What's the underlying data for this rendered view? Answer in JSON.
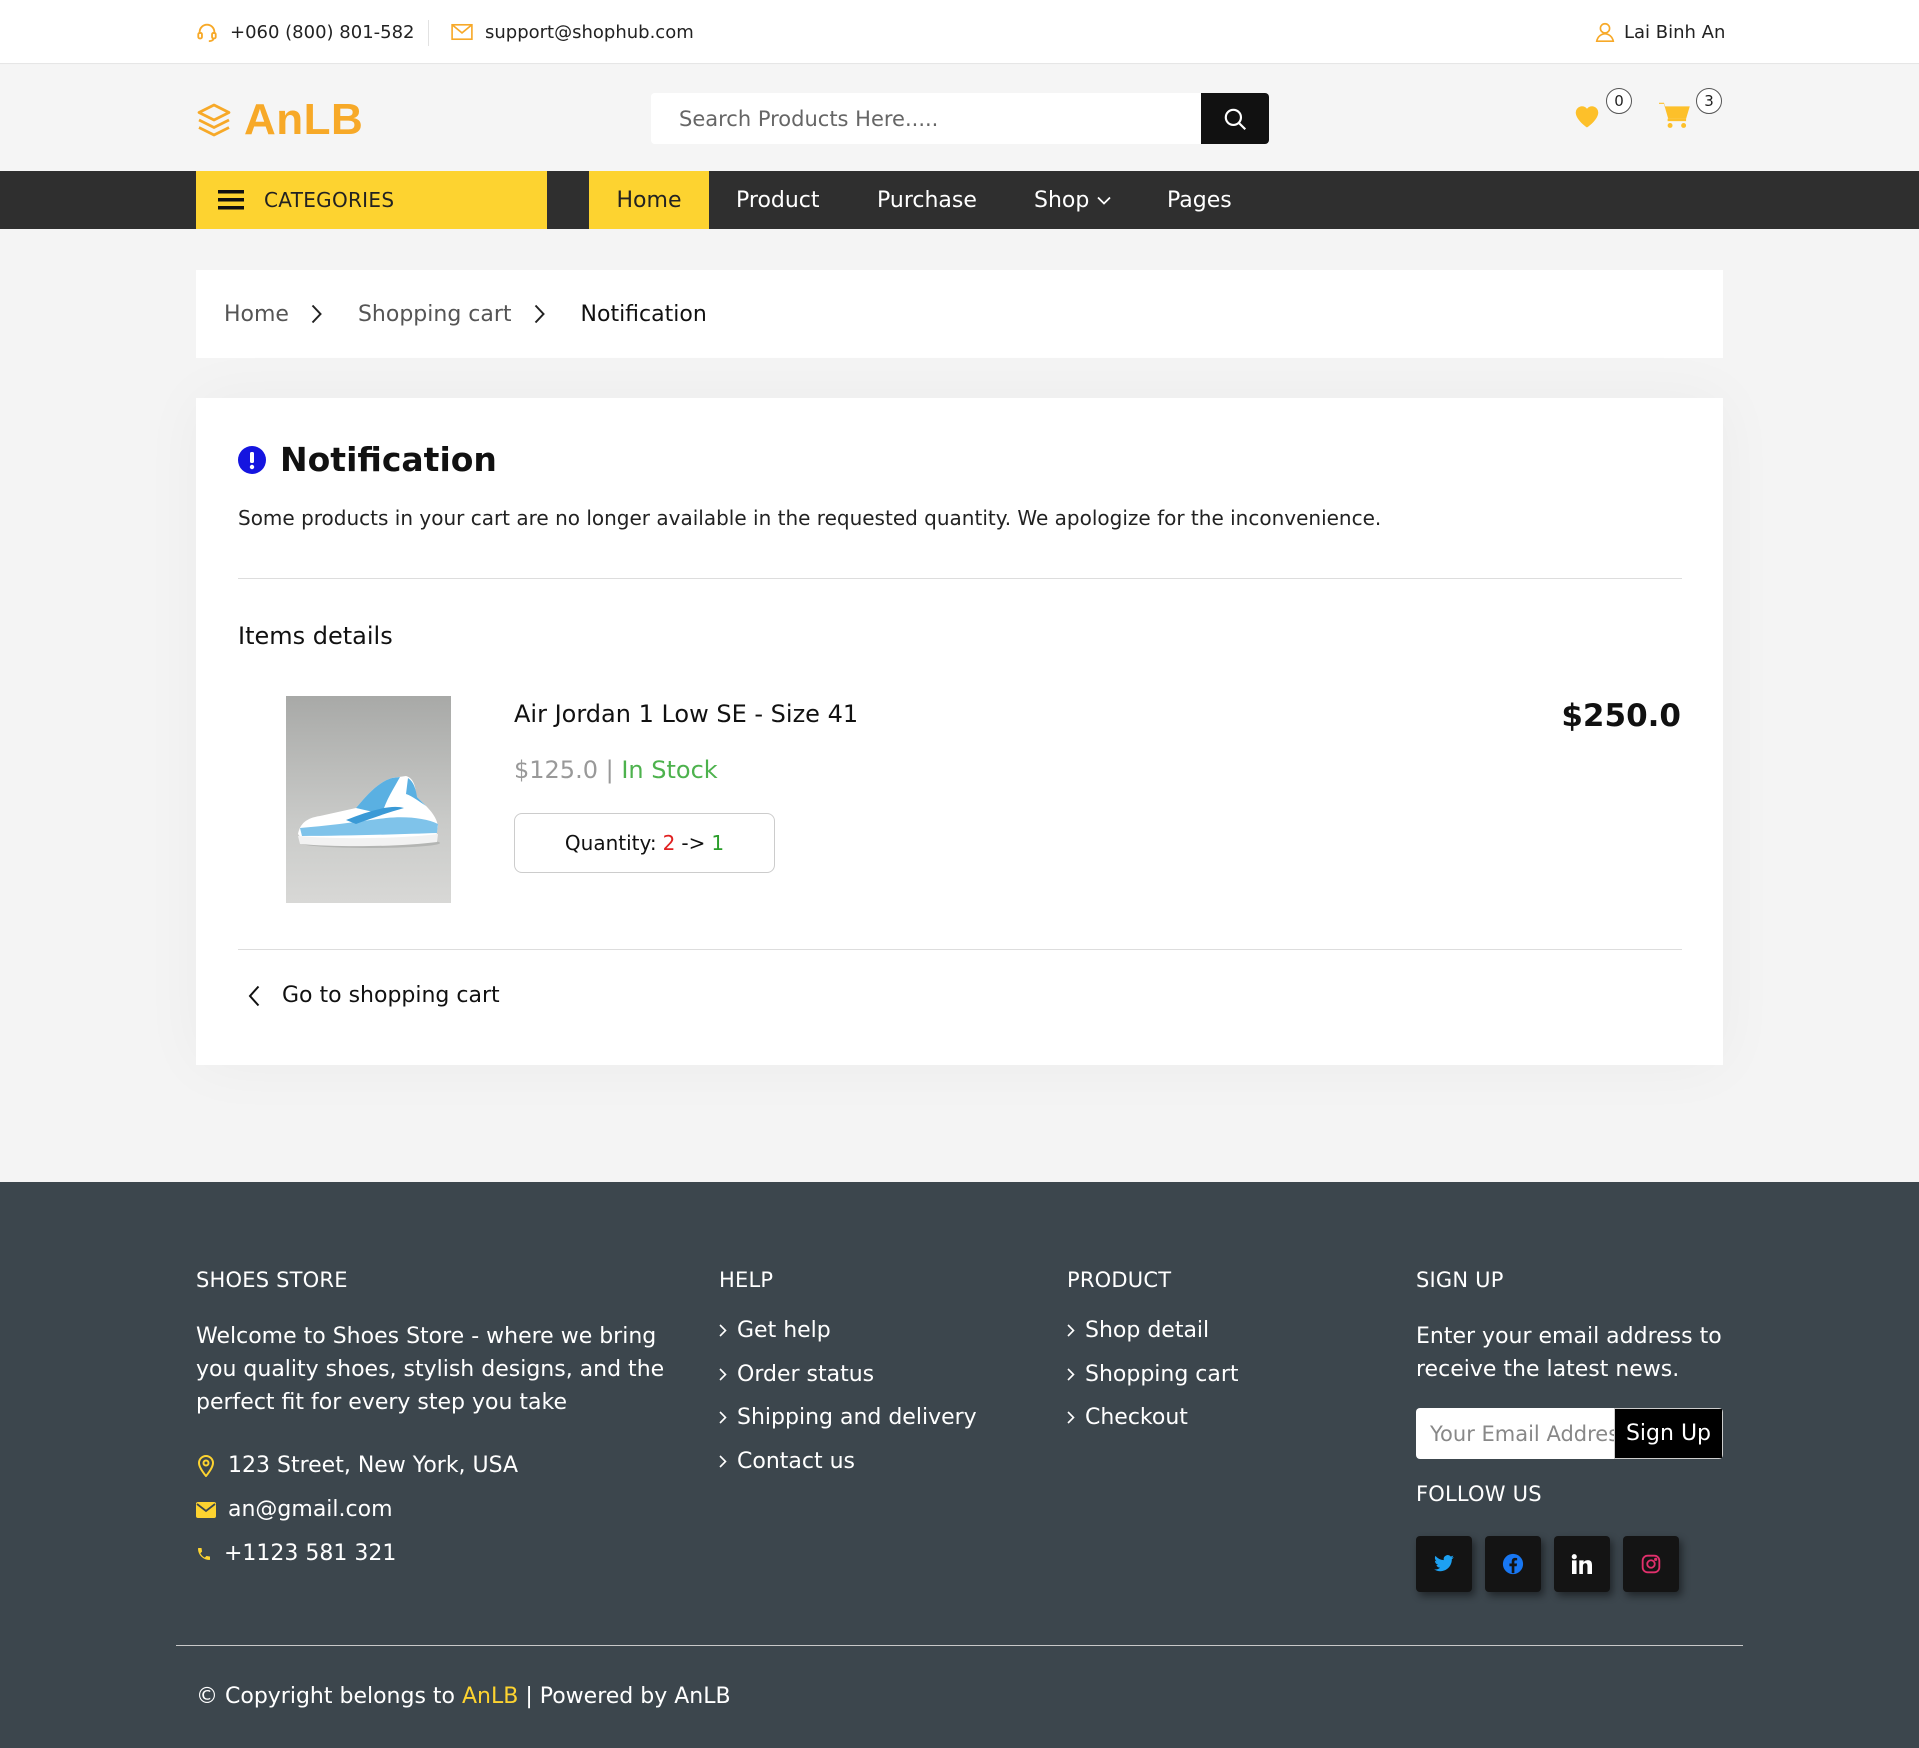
{
  "topbar": {
    "phone": "+060 (800) 801-582",
    "email": "support@shophub.com",
    "user": "Lai Binh An"
  },
  "header": {
    "logo": "AnLB",
    "search_placeholder": "Search Products Here.....",
    "wishlist_count": "0",
    "cart_count": "3"
  },
  "nav": {
    "categories": "CATEGORIES",
    "items": [
      "Home",
      "Product",
      "Purchase",
      "Shop",
      "Pages"
    ]
  },
  "breadcrumb": [
    "Home",
    "Shopping cart",
    "Notification"
  ],
  "notification": {
    "title": "Notification",
    "message": "Some products in your cart are no longer available in the requested quantity. We apologize for the inconvenience.",
    "items_title": "Items details",
    "item": {
      "name": "Air Jordan 1 Low SE - Size 41",
      "price": "$125.0",
      "separator": " | ",
      "stock": "In Stock",
      "quantity_label": "Quantity:",
      "quantity_old": "2",
      "quantity_arrow": "->",
      "quantity_new": "1",
      "total": "$250.0"
    },
    "back_label": "Go to shopping cart"
  },
  "footer": {
    "store": {
      "heading": "SHOES STORE",
      "description": "Welcome to Shoes Store - where we bring you quality shoes, stylish designs, and the perfect fit for every step you take",
      "address": "123 Street, New York, USA",
      "email": "an@gmail.com",
      "phone": "+1123 581 321"
    },
    "help": {
      "heading": "HELP",
      "links": [
        "Get help",
        "Order status",
        "Shipping and delivery",
        "Contact us"
      ]
    },
    "product": {
      "heading": "PRODUCT",
      "links": [
        "Shop detail",
        "Shopping cart",
        "Checkout"
      ]
    },
    "signup": {
      "heading": "SIGN UP",
      "text": "Enter your email address to receive the latest news.",
      "placeholder": "Your Email Address",
      "button": "Sign Up",
      "follow": "FOLLOW US"
    },
    "copyright_prefix": "© Copyright belongs to ",
    "copyright_brand": "AnLB",
    "copyright_suffix": " | Powered by AnLB"
  },
  "colors": {
    "accent_yellow": "#fdd330",
    "logo_orange": "#f7a928",
    "nav_dark": "#2f2f2f",
    "footer_bg": "#3c464d",
    "stock_green": "#4db24d",
    "qty_old_red": "#e02020",
    "notice_blue": "#1515e0"
  },
  "icons": {
    "phone": "headset-icon",
    "email": "envelope-icon",
    "user": "user-icon",
    "logo": "layers-icon",
    "search": "search-icon",
    "wishlist": "heart-icon",
    "cart": "cart-icon",
    "menu": "hamburger-icon",
    "notice": "exclamation-circle-icon"
  }
}
